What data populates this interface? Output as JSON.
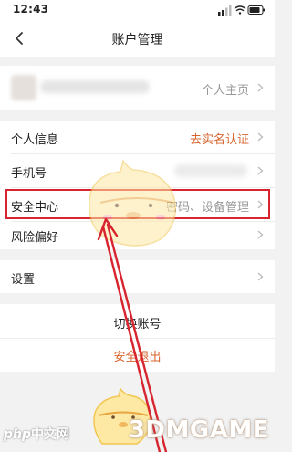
{
  "status_bar": {
    "time": "12:43"
  },
  "nav": {
    "title": "账户管理"
  },
  "profile": {
    "homepage_label": "个人主页"
  },
  "menu": {
    "personal_info": {
      "label": "个人信息",
      "value": "去实名认证"
    },
    "phone": {
      "label": "手机号"
    },
    "security": {
      "label": "安全中心",
      "value": "密码、设备管理"
    },
    "risk": {
      "label": "风险偏好"
    },
    "settings": {
      "label": "设置"
    }
  },
  "actions": {
    "switch_account": "切换账号",
    "logout": "安全退出"
  },
  "watermarks": {
    "left_php": "php",
    "left_text": "中文网",
    "right": "3DMGAME"
  },
  "colors": {
    "accent": "#d8642d",
    "highlight_box": "#d8242f",
    "page_bg": "#f2f2f2"
  }
}
